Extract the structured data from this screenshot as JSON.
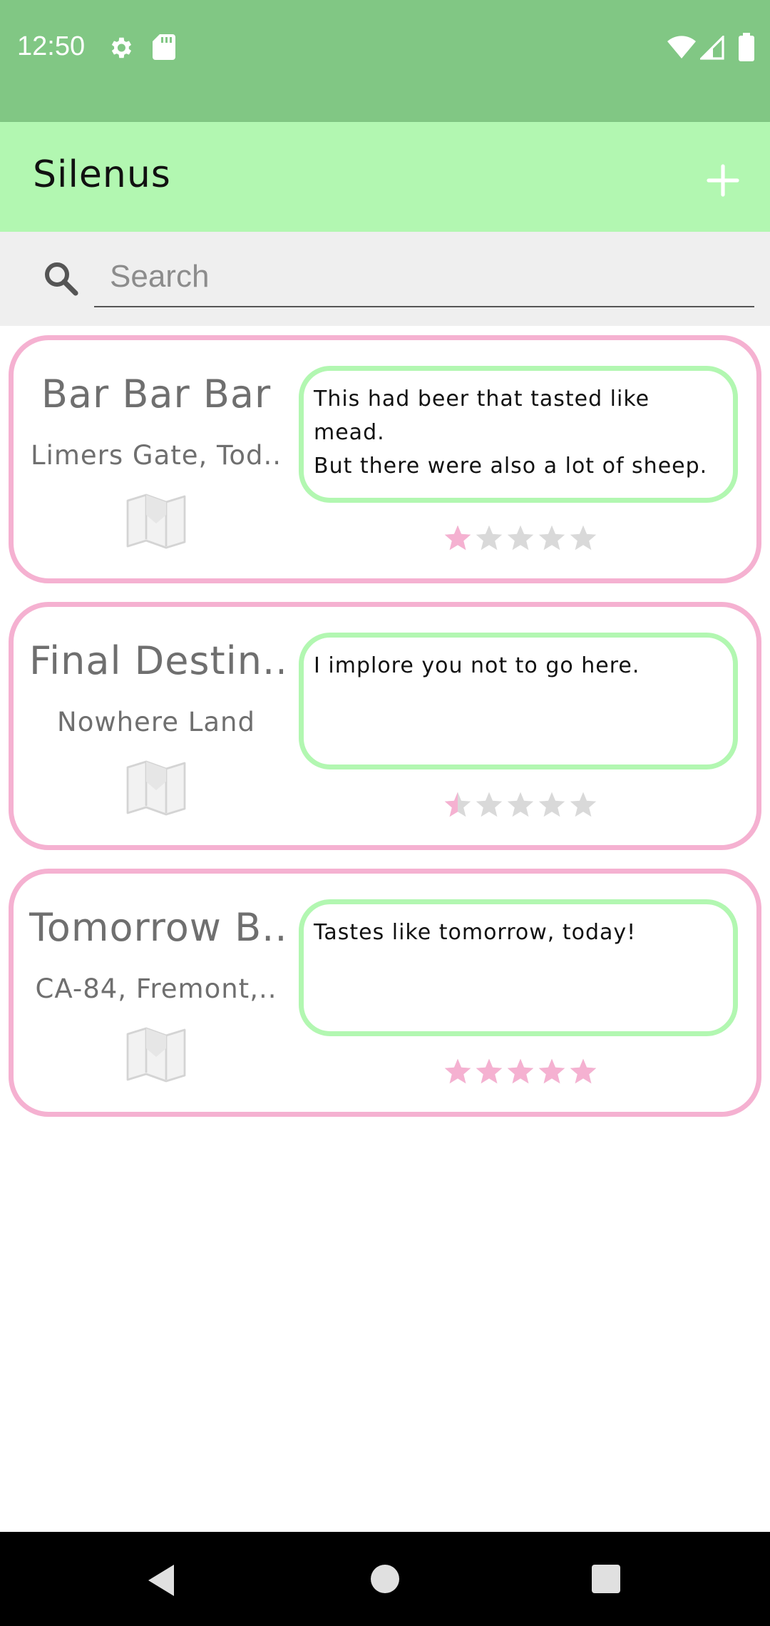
{
  "status_bar": {
    "time": "12:50",
    "icons": [
      "gear-icon",
      "sd-card-icon",
      "wifi-icon",
      "cell-signal-icon",
      "battery-icon"
    ]
  },
  "app_bar": {
    "title": "Silenus",
    "add_icon": "plus-icon"
  },
  "search": {
    "placeholder": "Search",
    "value": ""
  },
  "colors": {
    "status_bar": "#81c784",
    "app_bar": "#b2f7b1",
    "card_border": "#f5b1d1",
    "review_border": "#b2f7b1",
    "star_filled": "#f5b1d1",
    "star_empty": "#d9d9d9"
  },
  "bars": [
    {
      "name": "Bar Bar Bar",
      "address": "Limers Gate, Tod..",
      "review": "This had beer that tasted like mead.\nBut there were also a lot of sheep.",
      "rating": 1,
      "max_rating": 5
    },
    {
      "name": "Final Destin..",
      "address": "Nowhere Land",
      "review": "I implore you not to go here.",
      "rating": 0.5,
      "max_rating": 5
    },
    {
      "name": "Tomorrow B..",
      "address": "CA-84, Fremont,..",
      "review": "Tastes like tomorrow, today!",
      "rating": 5,
      "max_rating": 5
    }
  ],
  "nav_bar": {
    "buttons": [
      "back-icon",
      "home-icon",
      "recents-icon"
    ]
  }
}
